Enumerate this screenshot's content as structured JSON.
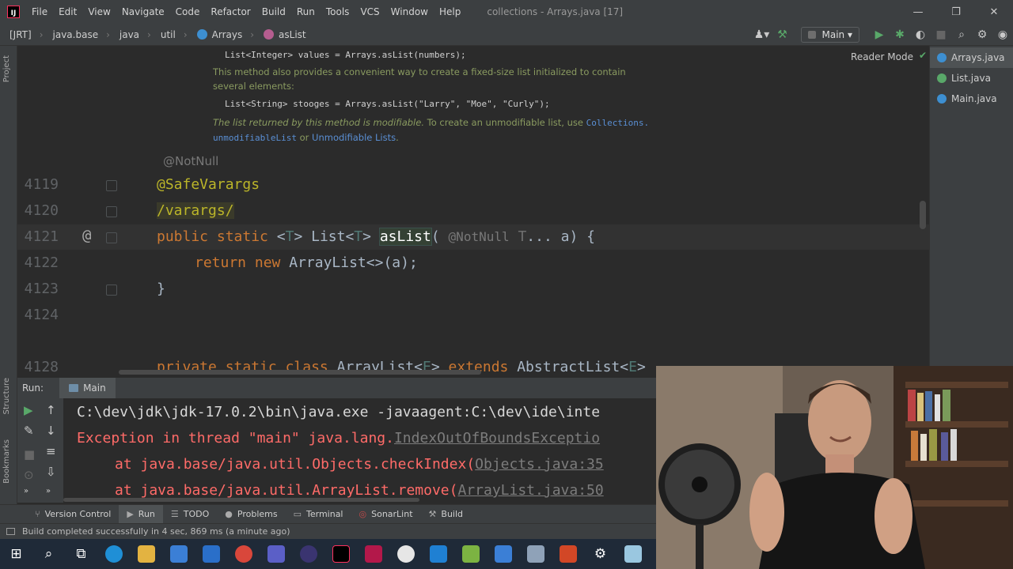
{
  "window": {
    "title": "collections - Arrays.java [17]",
    "menu": [
      "File",
      "Edit",
      "View",
      "Navigate",
      "Code",
      "Refactor",
      "Build",
      "Run",
      "Tools",
      "VCS",
      "Window",
      "Help"
    ],
    "controls": {
      "minimize": "—",
      "restore": "❐",
      "close": "✕"
    }
  },
  "breadcrumbs": [
    "[JRT]",
    "java.base",
    "java",
    "util",
    "Arrays",
    "asList"
  ],
  "run_config": "Main",
  "editor": {
    "reader_mode": "Reader Mode",
    "doc": {
      "code1": "List<Integer> values = Arrays.asList(numbers);",
      "text1": "This method also provides a convenient way to create a fixed-size list initialized to contain several elements:",
      "code2": "List<String> stooges = Arrays.asList(\"Larry\", \"Moe\", \"Curly\");",
      "text2_italic": "The list returned by this method is modifiable.",
      "text2_plain": " To create an unmodifiable list, use ",
      "link_collections": "Collections.",
      "link_unmodifiable": "unmodifiableList",
      "text2_or": " or ",
      "link_lists": "Unmodifiable Lists",
      "text2_end": "."
    },
    "annotation_hint": "@NotNull",
    "lines": [
      {
        "no": "4119",
        "code": "@SafeVarargs"
      },
      {
        "no": "4120",
        "code": "/varargs/"
      },
      {
        "no": "4121",
        "code": "public static <T> List<T> asList("
      },
      {
        "no": "4122",
        "code": "return new ArrayList<>(a);"
      },
      {
        "no": "4123",
        "code": "}"
      },
      {
        "no": "4124",
        "code": ""
      },
      {
        "no": "4128",
        "code": "private static class ArrayList<E> extends AbstractList<E>"
      }
    ],
    "line_4121": {
      "kw_public": "public",
      "kw_static": "static",
      "generic_open": "<",
      "t1": "T",
      "generic_close": "> List<",
      "t2": "T",
      "generic_close2": "> ",
      "method": "asList",
      "paren": "(",
      "param_hint": "@NotNull",
      "param_type": "T",
      "param_rest": "... a) {"
    },
    "line_4122": {
      "kw_return": "return",
      "kw_new": "new",
      "rest": "ArrayList<>(a);"
    },
    "line_4128": {
      "kw_private": "private",
      "kw_static": "static",
      "kw_class": "class",
      "name": "ArrayList<",
      "e1": "E",
      "mid": "> ",
      "kw_extends": "extends",
      "parent": "AbstractList<",
      "e2": "E",
      "end": ">"
    },
    "gutter_marker": "@"
  },
  "project_tabs": [
    "Arrays.java",
    "List.java",
    "Main.java"
  ],
  "run_panel": {
    "label": "Run:",
    "tab": "Main",
    "lines": {
      "cmd": "C:\\dev\\jdk\\jdk-17.0.2\\bin\\java.exe -javaagent:C:\\dev\\ide\\inte",
      "exc_prefix": "Exception in thread \"main\" java.lang.",
      "exc_link": "IndexOutOfBoundsExceptio",
      "at1_prefix": "at java.base/java.util.Objects.checkIndex(",
      "at1_link": "Objects.java:35",
      "at2_prefix": "at java.base/java.util.ArrayList.remove(",
      "at2_link": "ArrayList.java:50"
    }
  },
  "left_strip": {
    "project": "Project",
    "structure": "Structure",
    "bookmarks": "Bookmarks"
  },
  "bottom_tabs": [
    "Version Control",
    "Run",
    "TODO",
    "Problems",
    "Terminal",
    "SonarLint",
    "Build"
  ],
  "status": "Build completed successfully in 4 sec, 869 ms (a minute ago)",
  "colors": {
    "editor_bg": "#2b2b2b",
    "panel_bg": "#3c3f41",
    "keyword": "#cc7832",
    "annotation": "#bbb529",
    "error": "#ff6b68",
    "accent_green": "#59a869"
  }
}
